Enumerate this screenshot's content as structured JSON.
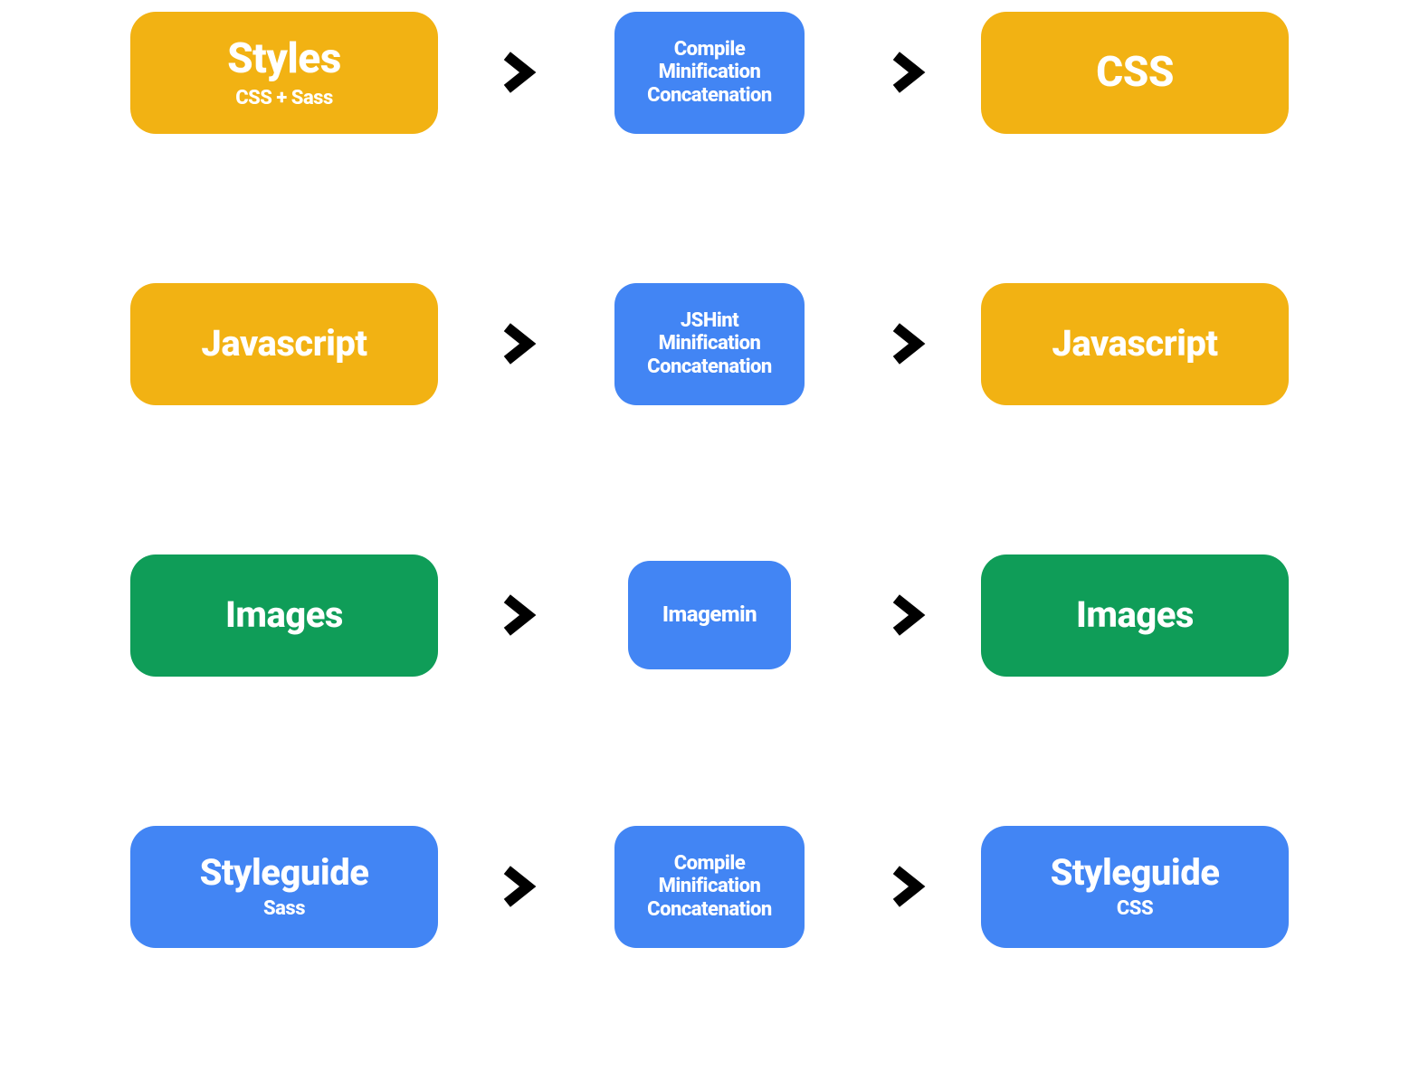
{
  "colors": {
    "yellow": "#f2b213",
    "blue": "#4285f4",
    "green": "#0f9d58"
  },
  "rows": [
    {
      "input": {
        "title": "Styles",
        "sub": "CSS + Sass",
        "color": "yellow"
      },
      "process": {
        "lines": [
          "Compile",
          "Minification",
          "Concatenation"
        ],
        "color": "blue"
      },
      "output": {
        "title": "CSS",
        "color": "yellow"
      }
    },
    {
      "input": {
        "title": "Javascript",
        "color": "yellow"
      },
      "process": {
        "lines": [
          "JSHint",
          "Minification",
          "Concatenation"
        ],
        "color": "blue"
      },
      "output": {
        "title": "Javascript",
        "color": "yellow"
      }
    },
    {
      "input": {
        "title": "Images",
        "color": "green"
      },
      "process": {
        "lines": [
          "Imagemin"
        ],
        "color": "blue",
        "small": true
      },
      "output": {
        "title": "Images",
        "color": "green"
      }
    },
    {
      "input": {
        "title": "Styleguide",
        "sub": "Sass",
        "color": "blue"
      },
      "process": {
        "lines": [
          "Compile",
          "Minification",
          "Concatenation"
        ],
        "color": "blue"
      },
      "output": {
        "title": "Styleguide",
        "sub": "CSS",
        "color": "blue"
      }
    }
  ]
}
